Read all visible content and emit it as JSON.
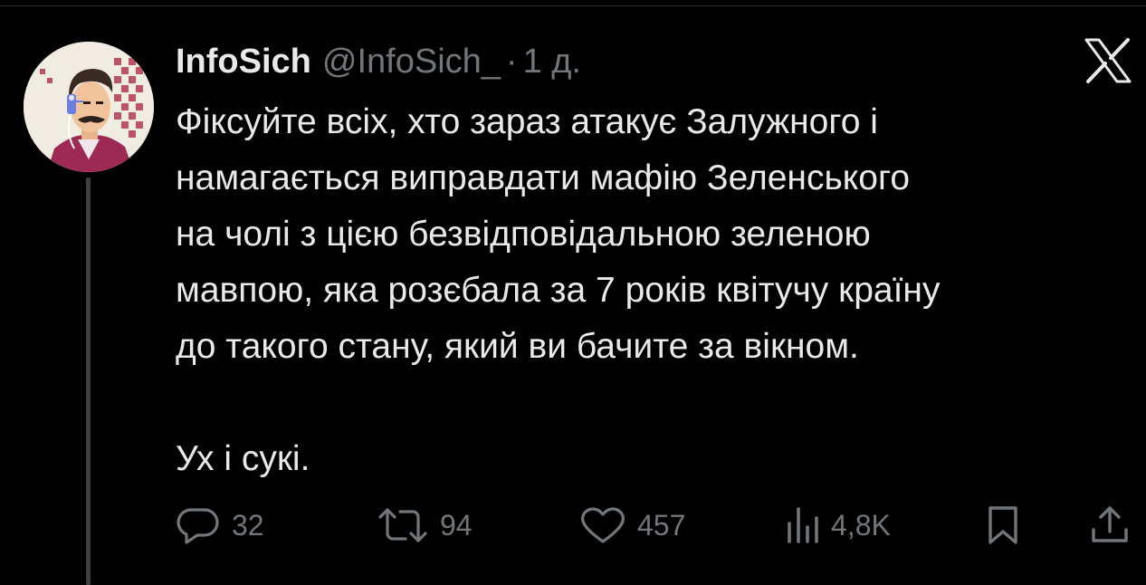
{
  "tweet": {
    "author": {
      "display_name": "InfoSich",
      "handle": "@InfoSich_",
      "avatar_icon": "avatar-illustration"
    },
    "separator": "·",
    "time": "1 д.",
    "text_lines": [
      "Фіксуйте всіх, хто зараз атакує Залужного і",
      "намагається виправдати мафію Зеленського",
      "на чолі з цією безвідповідальною зеленою",
      "мавпою, яка розєбала за 7 років квітучу країну",
      "до такого стану, який ви бачите за вікном.",
      "",
      "Ух і сукі."
    ],
    "actions": {
      "replies": "32",
      "reposts": "94",
      "likes": "457",
      "views": "4,8K"
    }
  },
  "colors": {
    "background": "#000000",
    "primary_text": "#e7e9ea",
    "secondary_text": "#71767b",
    "divider": "#2f3336",
    "thread_line": "#3e4144"
  },
  "icons": {
    "brand": "x-logo-icon",
    "reply": "reply-icon",
    "repost": "repost-icon",
    "like": "heart-icon",
    "views": "views-icon",
    "bookmark": "bookmark-icon",
    "share": "share-icon"
  }
}
